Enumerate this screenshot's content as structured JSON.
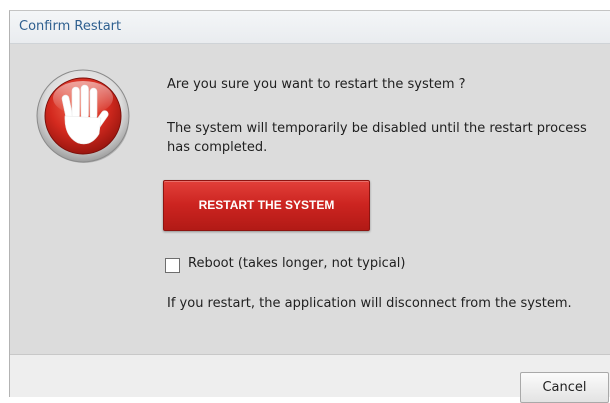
{
  "dialog": {
    "title": "Confirm Restart",
    "question": "Are you sure you want to restart the system ?",
    "warning": "The system will temporarily be disabled until the restart process has completed.",
    "restart_button_label": "RESTART THE SYSTEM",
    "reboot_checkbox_label": "Reboot (takes longer, not typical)",
    "reboot_checked": false,
    "disconnect_note": "If you restart, the application will disconnect from the system.",
    "cancel_button_label": "Cancel",
    "icon": "stop-hand-icon"
  },
  "colors": {
    "accent_red": "#cc2420",
    "title_blue": "#2e5f8f"
  }
}
